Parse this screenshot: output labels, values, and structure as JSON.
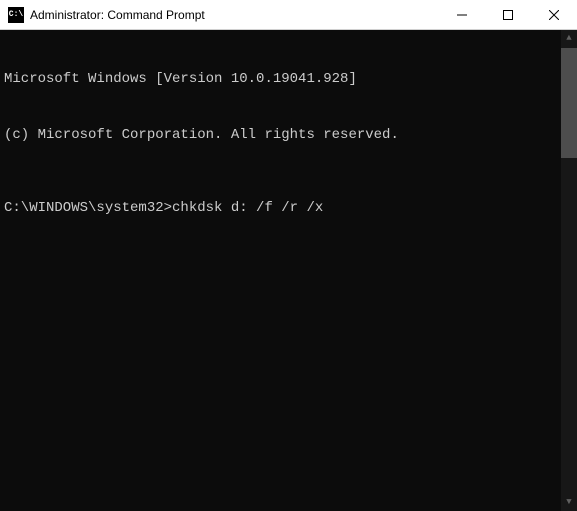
{
  "titlebar": {
    "icon_label": "C:\\",
    "title": "Administrator: Command Prompt"
  },
  "console": {
    "line1": "Microsoft Windows [Version 10.0.19041.928]",
    "line2": "(c) Microsoft Corporation. All rights reserved.",
    "prompt": "C:\\WINDOWS\\system32>",
    "command": "chkdsk d: /f /r /x"
  }
}
